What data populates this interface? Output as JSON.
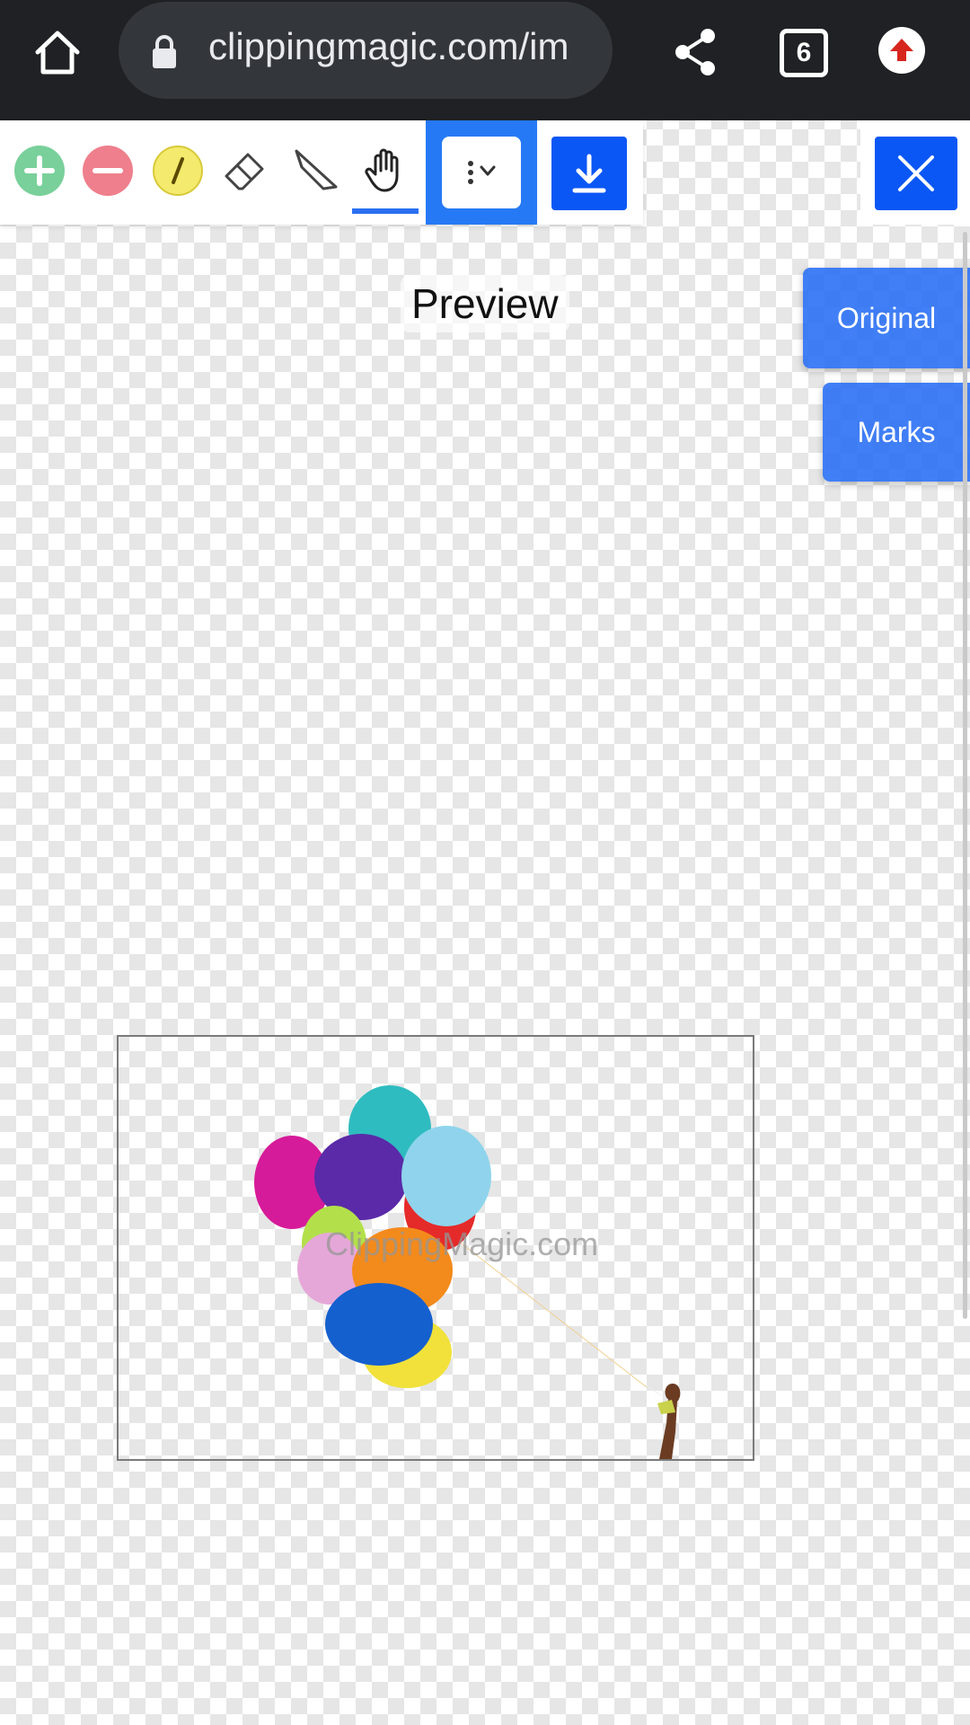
{
  "browser": {
    "url": "clippingmagic.com/im",
    "tab_count": "6"
  },
  "toolbar": {
    "tools": [
      "add-foreground",
      "remove-background",
      "hair",
      "eraser",
      "scalpel",
      "pan"
    ],
    "active_tool": "pan",
    "menu_icon": "more-vert-chevron-icon",
    "download_icon": "download-icon",
    "close_icon": "close-icon"
  },
  "canvas": {
    "preview_label": "Preview",
    "watermark": "ClippingMagic.com"
  },
  "side_panel": {
    "original_label": "Original",
    "marks_label": "Marks"
  },
  "colors": {
    "accent": "#0b57f5",
    "add": "#79d09a",
    "remove": "#ef7f8c",
    "hair": "#f4ea6d"
  }
}
